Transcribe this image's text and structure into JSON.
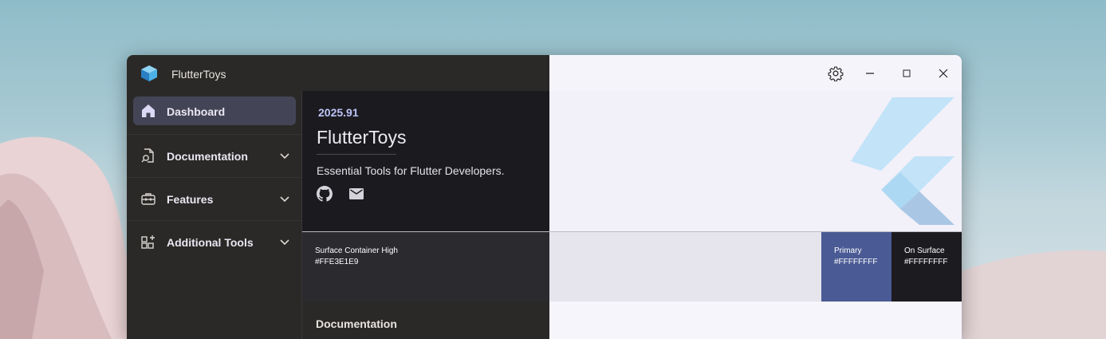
{
  "window": {
    "title": "FlutterToys",
    "controls": [
      "settings-icon",
      "minimize-icon",
      "maximize-icon",
      "close-icon"
    ]
  },
  "sidebar": {
    "items": [
      {
        "label": "Dashboard",
        "icon": "home-icon",
        "active": true
      },
      {
        "label": "Documentation",
        "icon": "document-search-icon",
        "expandable": true
      },
      {
        "label": "Features",
        "icon": "toolbox-icon",
        "expandable": true
      },
      {
        "label": "Additional Tools",
        "icon": "add-apps-icon",
        "expandable": true
      }
    ]
  },
  "hero": {
    "version": "2025.91",
    "title": "FlutterToys",
    "subtitle": "Essential Tools for Flutter Developers.",
    "links": [
      "github-icon",
      "mail-icon"
    ]
  },
  "palette": {
    "surface": {
      "name": "Surface Container High",
      "hex": "#FFE3E1E9"
    },
    "primary": {
      "name": "Primary",
      "hex": "#FFFFFFFF",
      "color": "#4a5a94"
    },
    "on_surface": {
      "name": "On Surface",
      "hex": "#FFFFFFFF",
      "color": "#1c1b1f"
    }
  },
  "sections": {
    "documentation_heading": "Documentation"
  },
  "colors": {
    "accent": "#bcc2f7",
    "sidebar_bg": "#2b2927",
    "active_item_bg": "#434556",
    "hero_dark_bg": "#1b1b1f",
    "hero_light_bg": "#f2f0f9"
  }
}
